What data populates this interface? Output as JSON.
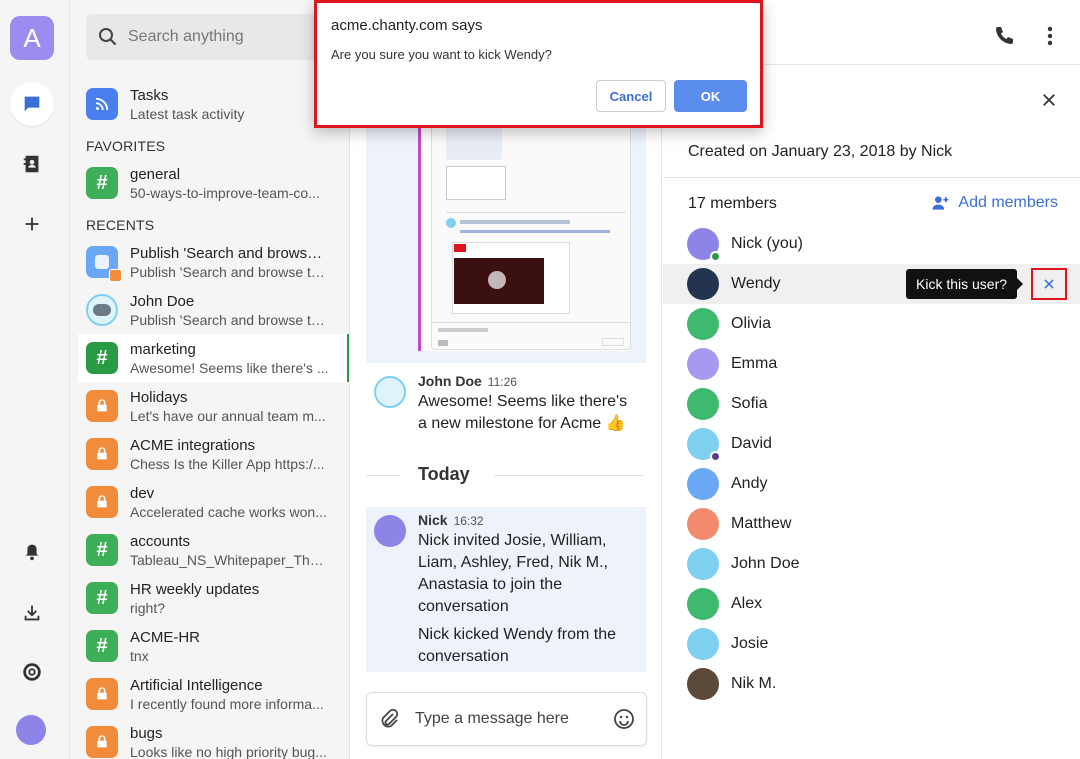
{
  "workspace": {
    "initial": "A"
  },
  "search": {
    "placeholder": "Search anything"
  },
  "sections": {
    "favorites": "FAVORITES",
    "recents": "RECENTS"
  },
  "colors": {
    "green": "#2b9a45",
    "orange": "#f28b3a",
    "blue": "#4a7ff0",
    "accent": "#3a6fd8",
    "danger": "#e0141e"
  },
  "conversations": [
    {
      "name": "Tasks",
      "sub": "Latest task activity",
      "icon": "rss-icon",
      "color": "#4a7ff0"
    },
    {
      "name": "general",
      "sub": "50-ways-to-improve-team-co...",
      "icon": "hash-icon",
      "color": "#3fae58"
    },
    {
      "name": "Publish 'Search and browse ...",
      "sub": "Publish 'Search and browse ta...",
      "icon": "task-icon",
      "color": "#6aa7f5"
    },
    {
      "name": "John Doe",
      "sub": "Publish 'Search and browse ta...",
      "icon": "avatar",
      "color": "#7fd0f0"
    },
    {
      "name": "marketing",
      "sub": "Awesome! Seems like there's ...",
      "icon": "hash-icon",
      "color": "#2b9a45"
    },
    {
      "name": "Holidays",
      "sub": "Let's have our annual team m...",
      "icon": "lock-icon",
      "color": "#f28b3a"
    },
    {
      "name": "ACME integrations",
      "sub": "Chess Is the Killer App https:/...",
      "icon": "lock-icon",
      "color": "#f28b3a"
    },
    {
      "name": "dev",
      "sub": "Accelerated cache works won...",
      "icon": "lock-icon",
      "color": "#f28b3a"
    },
    {
      "name": "accounts",
      "sub": "Tableau_NS_Whitepaper_The_...",
      "icon": "hash-icon",
      "color": "#3fae58"
    },
    {
      "name": "HR weekly updates",
      "sub": "right?",
      "icon": "hash-icon",
      "color": "#3fae58"
    },
    {
      "name": "ACME-HR",
      "sub": "tnx",
      "icon": "hash-icon",
      "color": "#3fae58"
    },
    {
      "name": "Artificial Intelligence",
      "sub": "I recently found more informa...",
      "icon": "lock-icon",
      "color": "#f28b3a"
    },
    {
      "name": "bugs",
      "sub": "Looks like no high priority bug...",
      "icon": "lock-icon",
      "color": "#f28b3a"
    }
  ],
  "chat": {
    "messages": [
      {
        "author": "John Doe",
        "time": "11:26",
        "text": "Awesome! Seems like there's a new milestone for Acme 👍"
      },
      {
        "author": "Nick",
        "time": "16:32",
        "text": "Nick invited Josie, William, Liam, Ashley, Fred, Nik M., Anastasia to join the conversation",
        "text2": "Nick kicked Wendy from the conversation"
      }
    ],
    "day_separator": "Today",
    "composer_placeholder": "Type a message here"
  },
  "panel": {
    "created": "Created on January 23, 2018 by Nick",
    "members_count": "17 members",
    "add_members": "Add members",
    "tooltip": "Kick this user?",
    "members": [
      {
        "name": "Nick (you)",
        "color": "#8d84e8",
        "status": "#2b9a45"
      },
      {
        "name": "Wendy",
        "color": "#24344f"
      },
      {
        "name": "Olivia",
        "color": "#3fb870"
      },
      {
        "name": "Emma",
        "color": "#a69af0"
      },
      {
        "name": "Sofia",
        "color": "#3fb870"
      },
      {
        "name": "David",
        "color": "#7fd0f0",
        "status": "#5a3b8c"
      },
      {
        "name": "Andy",
        "color": "#6aa7f5"
      },
      {
        "name": "Matthew",
        "color": "#f28b6e"
      },
      {
        "name": "John Doe",
        "color": "#7fd0f0"
      },
      {
        "name": "Alex",
        "color": "#3fb870"
      },
      {
        "name": "Josie",
        "color": "#7fd0f0"
      },
      {
        "name": "Nik M.",
        "color": "#5a4a3a"
      }
    ]
  },
  "dialog": {
    "title": "acme.chanty.com says",
    "message": "Are you sure you want to kick Wendy?",
    "cancel": "Cancel",
    "ok": "OK"
  }
}
